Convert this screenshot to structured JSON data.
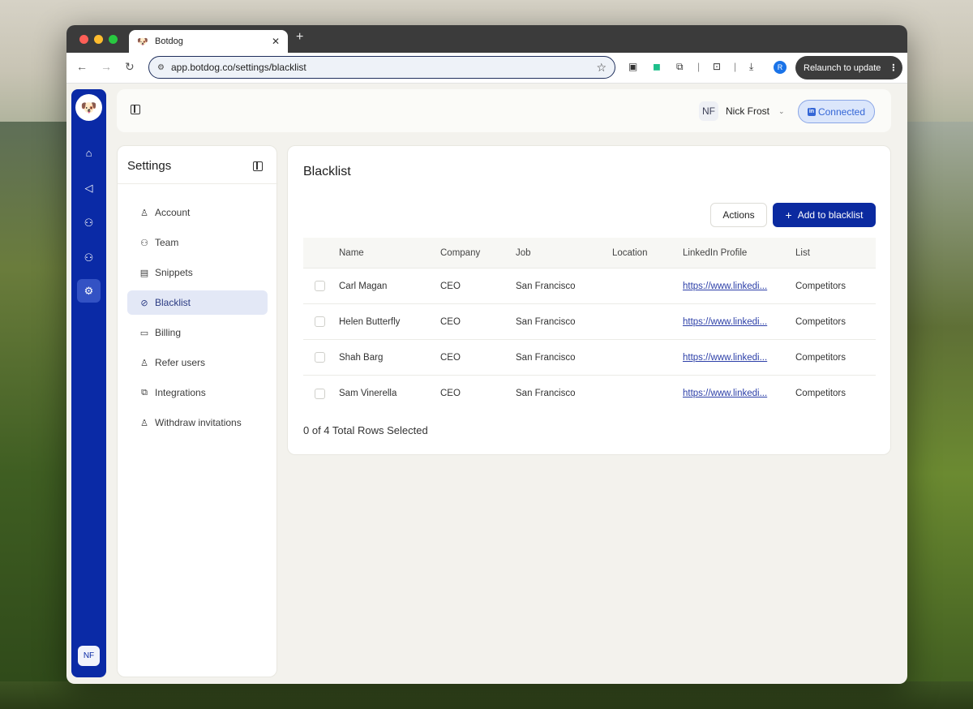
{
  "browser": {
    "tab_title": "Botdog",
    "url": "app.botdog.co/settings/blacklist",
    "relaunch_label": "Relaunch to update",
    "profile_initial": "R"
  },
  "app": {
    "rail_avatar": "NF",
    "user": {
      "initials": "NF",
      "name": "Nick Frost"
    },
    "connection_status": "Connected"
  },
  "settings": {
    "title": "Settings",
    "items": [
      {
        "label": "Account",
        "icon": "user-icon"
      },
      {
        "label": "Team",
        "icon": "team-icon"
      },
      {
        "label": "Snippets",
        "icon": "document-icon"
      },
      {
        "label": "Blacklist",
        "icon": "block-icon",
        "active": true
      },
      {
        "label": "Billing",
        "icon": "credit-card-icon"
      },
      {
        "label": "Refer users",
        "icon": "user-plus-icon"
      },
      {
        "label": "Integrations",
        "icon": "puzzle-icon"
      },
      {
        "label": "Withdraw invitations",
        "icon": "user-minus-icon"
      }
    ]
  },
  "blacklist": {
    "title": "Blacklist",
    "actions_label": "Actions",
    "add_label": "Add to blacklist",
    "columns": [
      "Name",
      "Company",
      "Job",
      "Location",
      "LinkedIn Profile",
      "List"
    ],
    "rows": [
      {
        "name": "Carl Magan",
        "company": "CEO",
        "job": "San Francisco",
        "location": "",
        "linkedin": "https://www.linkedi...",
        "list": "Competitors"
      },
      {
        "name": "Helen Butterfly",
        "company": "CEO",
        "job": "San Francisco",
        "location": "",
        "linkedin": "https://www.linkedi...",
        "list": "Competitors"
      },
      {
        "name": "Shah Barg",
        "company": "CEO",
        "job": "San Francisco",
        "location": "",
        "linkedin": "https://www.linkedi...",
        "list": "Competitors"
      },
      {
        "name": "Sam Vinerella",
        "company": "CEO",
        "job": "San Francisco",
        "location": "",
        "linkedin": "https://www.linkedi...",
        "list": "Competitors"
      }
    ],
    "selection_status": "0 of 4 Total Rows Selected"
  },
  "colors": {
    "brand": "#0a2aa6",
    "primary_button": "#0b2aa0",
    "connected_bg": "#dbe6fb"
  }
}
